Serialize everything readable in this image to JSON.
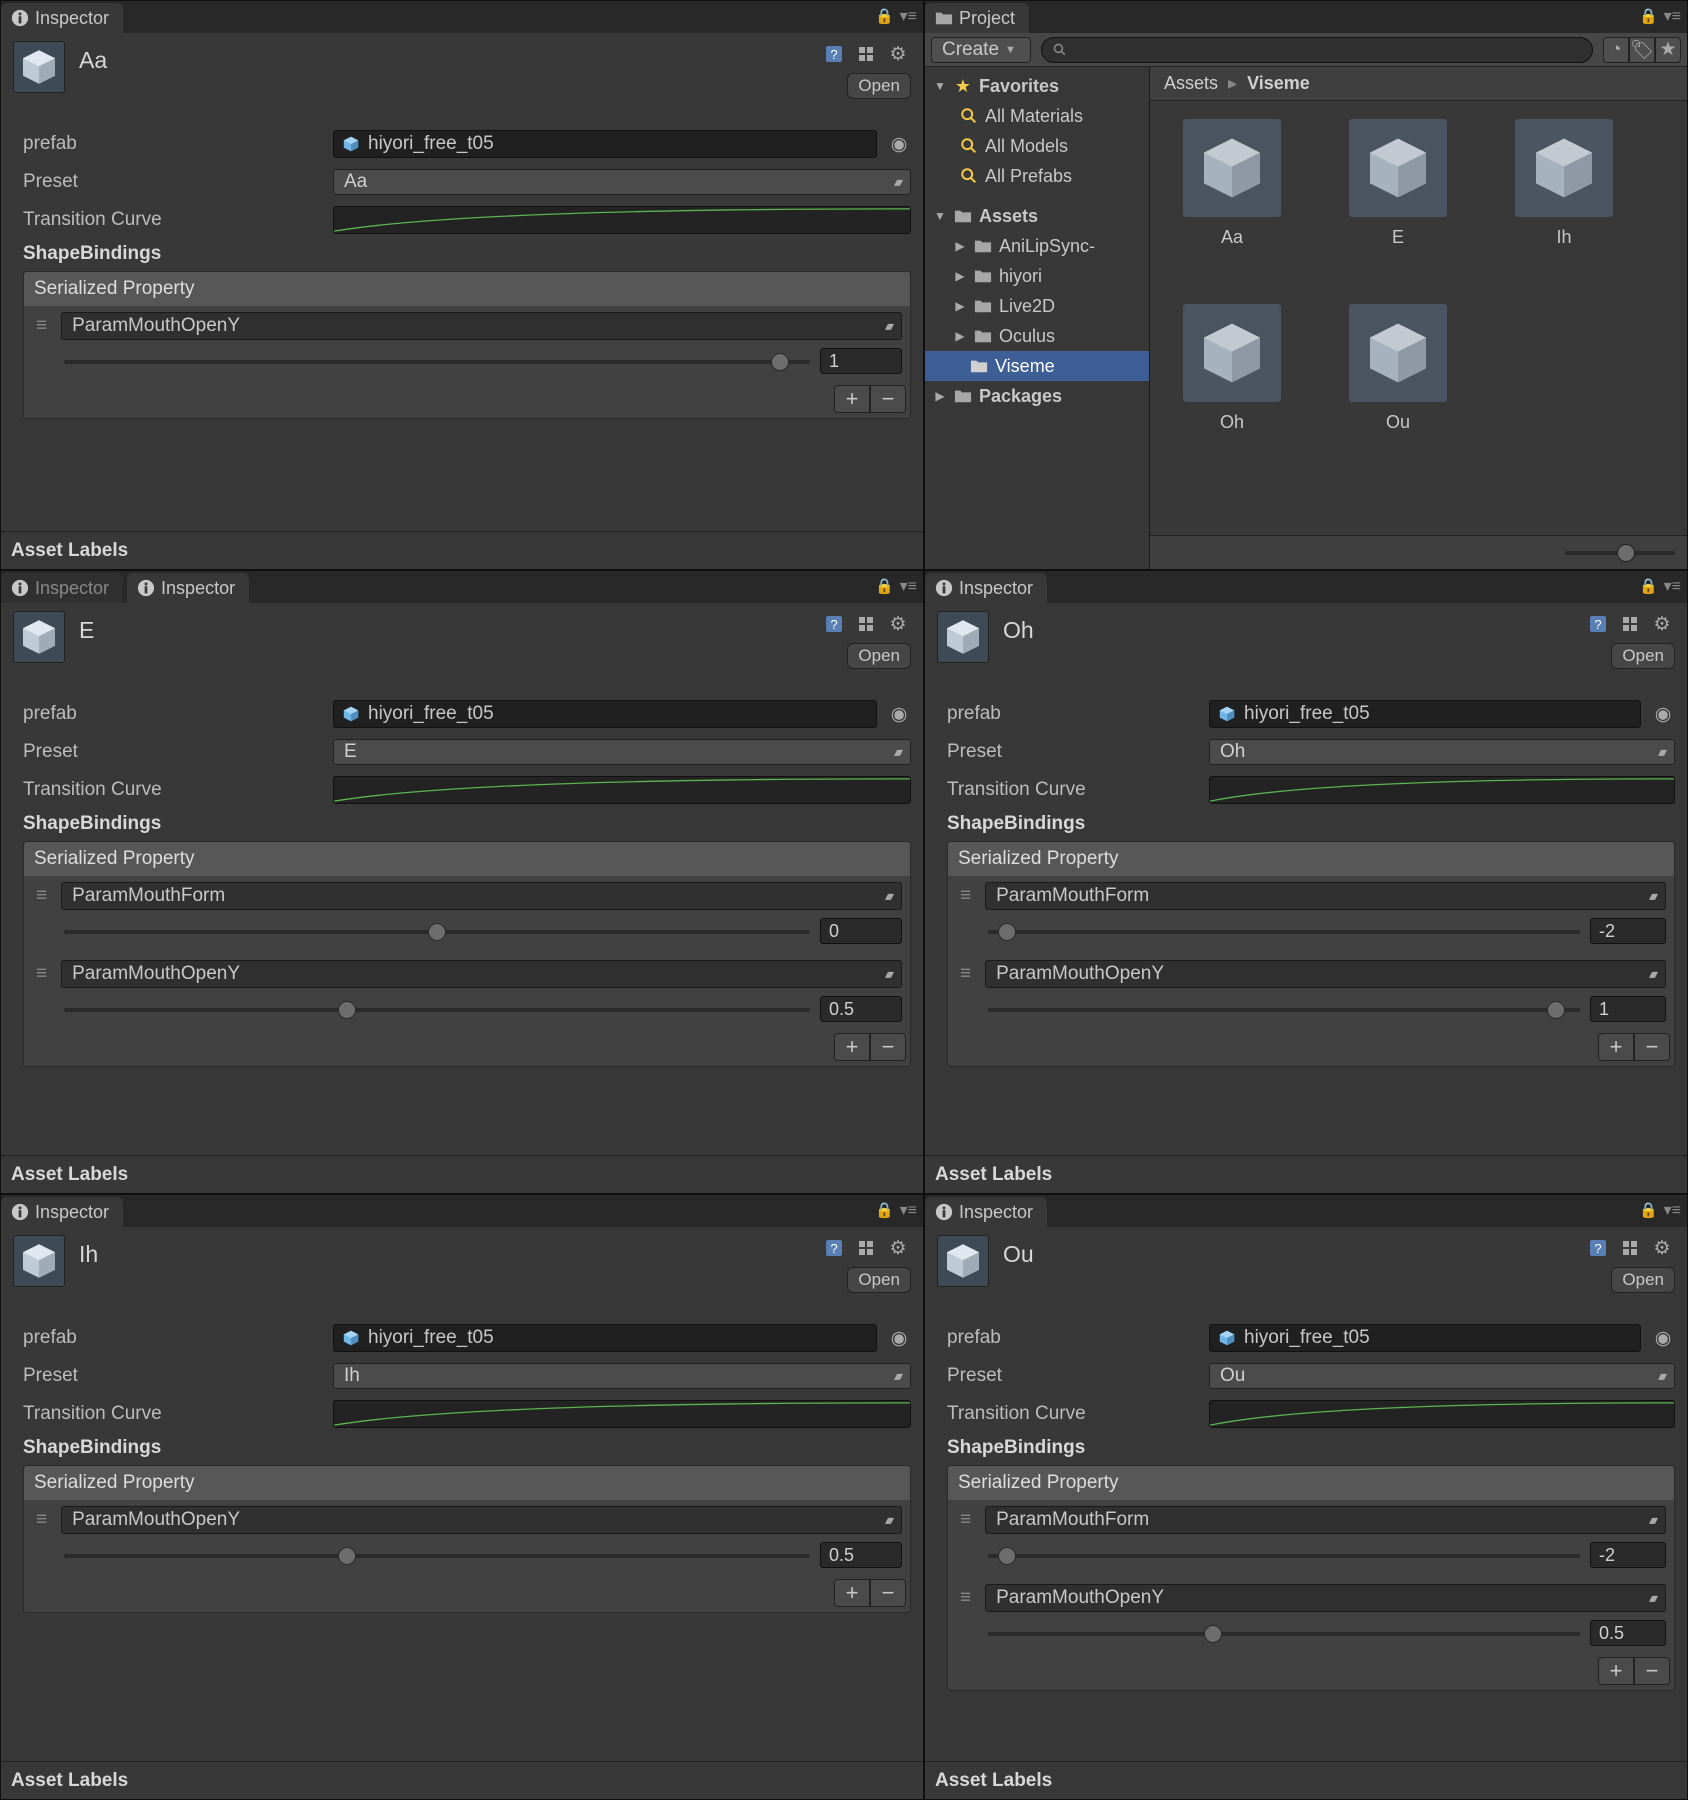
{
  "labels": {
    "inspector": "Inspector",
    "project": "Project",
    "create": "Create",
    "open": "Open",
    "prefab": "prefab",
    "preset": "Preset",
    "transition_curve": "Transition Curve",
    "shape_bindings": "ShapeBindings",
    "serialized_property": "Serialized Property",
    "asset_labels": "Asset Labels",
    "plus": "+",
    "minus": "−"
  },
  "prefab_value": "hiyori_free_t05",
  "params": {
    "mouth_open": "ParamMouthOpenY",
    "mouth_form": "ParamMouthForm"
  },
  "project": {
    "favorites": "Favorites",
    "all_materials": "All Materials",
    "all_models": "All Models",
    "all_prefabs": "All Prefabs",
    "assets": "Assets",
    "folders": [
      "AniLipSync-",
      "hiyori",
      "Live2D",
      "Oculus",
      "Viseme"
    ],
    "packages": "Packages",
    "breadcrumb": [
      "Assets",
      "Viseme"
    ],
    "items": [
      "Aa",
      "E",
      "Ih",
      "Oh",
      "Ou"
    ]
  },
  "inspectors": {
    "aa": {
      "name": "Aa",
      "preset": "Aa",
      "bindings": [
        {
          "param": "ParamMouthOpenY",
          "value": "1",
          "pos": 0.96
        }
      ]
    },
    "e": {
      "name": "E",
      "preset": "E",
      "bindings": [
        {
          "param": "ParamMouthForm",
          "value": "0",
          "pos": 0.5
        },
        {
          "param": "ParamMouthOpenY",
          "value": "0.5",
          "pos": 0.38
        }
      ]
    },
    "oh": {
      "name": "Oh",
      "preset": "Oh",
      "bindings": [
        {
          "param": "ParamMouthForm",
          "value": "-2",
          "pos": 0.02
        },
        {
          "param": "ParamMouthOpenY",
          "value": "1",
          "pos": 0.96
        }
      ]
    },
    "ih": {
      "name": "Ih",
      "preset": "Ih",
      "bindings": [
        {
          "param": "ParamMouthOpenY",
          "value": "0.5",
          "pos": 0.38
        }
      ]
    },
    "ou": {
      "name": "Ou",
      "preset": "Ou",
      "bindings": [
        {
          "param": "ParamMouthForm",
          "value": "-2",
          "pos": 0.02
        },
        {
          "param": "ParamMouthOpenY",
          "value": "0.5",
          "pos": 0.38
        }
      ]
    }
  }
}
